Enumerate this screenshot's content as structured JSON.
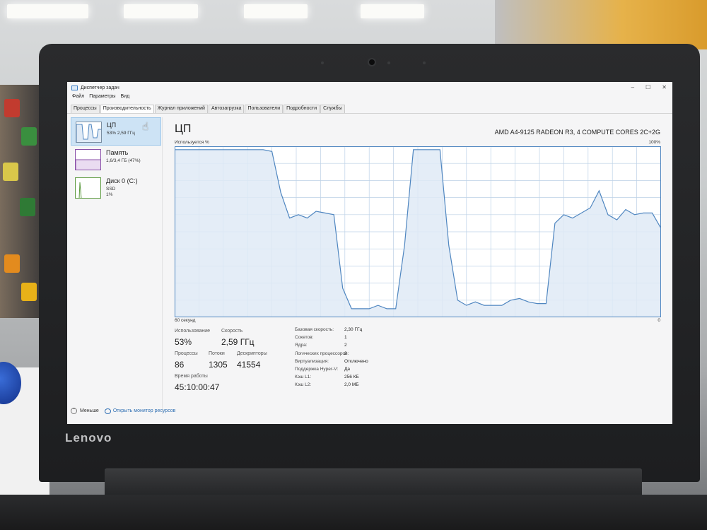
{
  "window": {
    "title": "Диспетчер задач",
    "controls": {
      "minimize": "–",
      "maximize": "☐",
      "close": "✕"
    }
  },
  "menu": [
    "Файл",
    "Параметры",
    "Вид"
  ],
  "tabs": [
    {
      "label": "Процессы",
      "active": false
    },
    {
      "label": "Производительность",
      "active": true
    },
    {
      "label": "Журнал приложений",
      "active": false
    },
    {
      "label": "Автозагрузка",
      "active": false
    },
    {
      "label": "Пользователи",
      "active": false
    },
    {
      "label": "Подробности",
      "active": false
    },
    {
      "label": "Службы",
      "active": false
    }
  ],
  "sidebar": {
    "items": [
      {
        "title": "ЦП",
        "sub1": "53% 2,59 ГГц",
        "sub2": "",
        "active": true
      },
      {
        "title": "Память",
        "sub1": "1,6/3,4 ГБ (47%)",
        "sub2": "",
        "active": false
      },
      {
        "title": "Диск 0 (C:)",
        "sub1": "SSD",
        "sub2": "1%",
        "active": false
      }
    ]
  },
  "main": {
    "title": "ЦП",
    "model": "AMD A4-9125 RADEON R3, 4 COMPUTE CORES 2C+2G",
    "util_label": "Используется %",
    "max_label": "100%",
    "time_label": "60 секунд",
    "zero_label": "0"
  },
  "stats": {
    "usage_label": "Использование",
    "usage_value": "53%",
    "speed_label": "Скорость",
    "speed_value": "2,59 ГГц",
    "processes_label": "Процессы",
    "processes_value": "86",
    "threads_label": "Потоки",
    "threads_value": "1305",
    "handles_label": "Дескрипторы",
    "handles_value": "41554",
    "uptime_label": "Время работы",
    "uptime_value": "45:10:00:47"
  },
  "specs": [
    {
      "label": "Базовая скорость:",
      "value": "2,30 ГГц"
    },
    {
      "label": "Сокетов:",
      "value": "1"
    },
    {
      "label": "Ядра:",
      "value": "2"
    },
    {
      "label": "Логических процессоров:",
      "value": "2"
    },
    {
      "label": "Виртуализация:",
      "value": "Отключено"
    },
    {
      "label": "Поддержка Hyper-V:",
      "value": "Да"
    },
    {
      "label": "Кэш L1:",
      "value": "256 КБ"
    },
    {
      "label": "Кэш L2:",
      "value": "2,0 МБ"
    }
  ],
  "footer": {
    "less_label": "Меньше",
    "monitor_label": "Открыть монитор ресурсов"
  },
  "brand": "Lenovo",
  "cpu_history": [
    98,
    98,
    98,
    98,
    98,
    98,
    98,
    98,
    98,
    98,
    98,
    97,
    73,
    58,
    60,
    58,
    62,
    61,
    60,
    17,
    5,
    5,
    5,
    7,
    5,
    5,
    42,
    98,
    98,
    98,
    98,
    42,
    10,
    7,
    9,
    7,
    7,
    7,
    10,
    11,
    9,
    8,
    8,
    55,
    60,
    58,
    61,
    64,
    74,
    60,
    57,
    63,
    60,
    61,
    61,
    52
  ],
  "colors": {
    "cpu_line": "#4f86c0",
    "cpu_fill": "#dfeaf6",
    "grid": "#bcd1e6",
    "memory_line": "#8a4fa8",
    "disk_line": "#5d9b40",
    "link": "#2f6fb3"
  }
}
